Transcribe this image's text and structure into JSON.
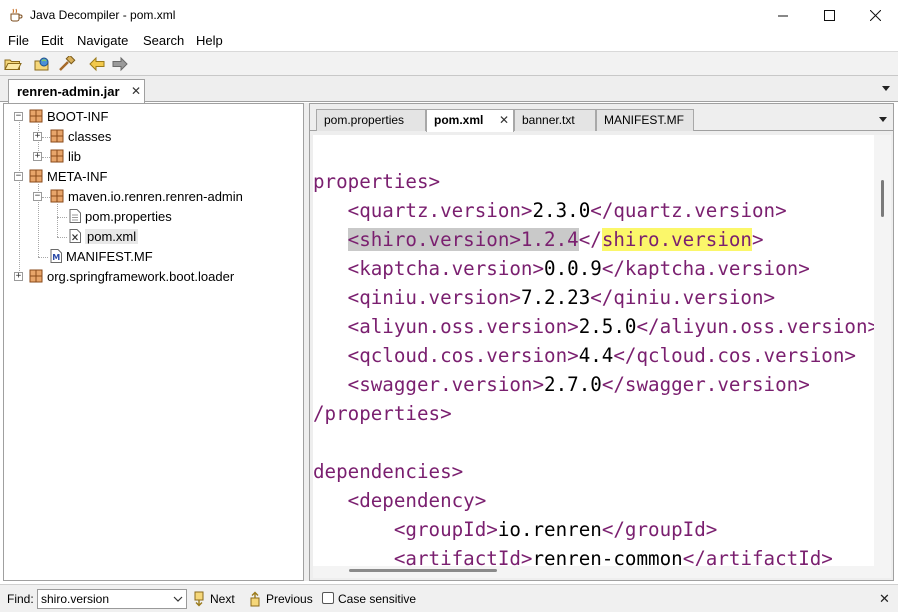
{
  "window": {
    "title": "Java Decompiler - pom.xml"
  },
  "menu": {
    "items": [
      "File",
      "Edit",
      "Navigate",
      "Search",
      "Help"
    ]
  },
  "toolbar": {
    "icons": [
      "open-folder-icon",
      "open-type-icon",
      "search-hammer-icon",
      "back-arrow-icon",
      "forward-arrow-icon"
    ]
  },
  "jar_tab": {
    "label": "renren-admin.jar",
    "close": "✕"
  },
  "tree": {
    "nodes": [
      {
        "label": "BOOT-INF",
        "type": "package",
        "expanded": true
      },
      {
        "label": "classes",
        "type": "package",
        "expanded": false
      },
      {
        "label": "lib",
        "type": "package",
        "expanded": false
      },
      {
        "label": "META-INF",
        "type": "package",
        "expanded": true
      },
      {
        "label": "maven.io.renren.renren-admin",
        "type": "package",
        "expanded": true
      },
      {
        "label": "pom.properties",
        "type": "file"
      },
      {
        "label": "pom.xml",
        "type": "xml-file",
        "selected": true
      },
      {
        "label": "MANIFEST.MF",
        "type": "manifest-file"
      },
      {
        "label": "org.springframework.boot.loader",
        "type": "package",
        "expanded": false
      }
    ]
  },
  "file_tabs": {
    "tabs": [
      "pom.properties",
      "pom.xml",
      "banner.txt",
      "MANIFEST.MF"
    ],
    "active": "pom.xml",
    "close": "✕"
  },
  "editor": {
    "lines": [
      {
        "t1": "properties>"
      },
      {
        "t1": "   <quartz.version>",
        "t2": "2.3.0",
        "t3": "</quartz.version>"
      },
      {
        "t1": "   ",
        "sel1": "<shiro.version>1.2.4",
        "t3": "</",
        "match": "shiro.version",
        "t4": ">"
      },
      {
        "t1": "   <kaptcha.version>",
        "t2": "0.0.9",
        "t3": "</kaptcha.version>"
      },
      {
        "t1": "   <qiniu.version>",
        "t2": "7.2.23",
        "t3": "</qiniu.version>"
      },
      {
        "t1": "   <aliyun.oss.version>",
        "t2": "2.5.0",
        "t3": "</aliyun.oss.version>"
      },
      {
        "t1": "   <qcloud.cos.version>",
        "t2": "4.4",
        "t3": "</qcloud.cos.version>"
      },
      {
        "t1": "   <swagger.version>",
        "t2": "2.7.0",
        "t3": "</swagger.version>"
      },
      {
        "t1": "/properties>"
      },
      {
        "t1": ""
      },
      {
        "t1": "dependencies>"
      },
      {
        "t1": "   <dependency>"
      },
      {
        "t1": "       <groupId>",
        "t2": "io.renren",
        "t3": "</groupId>"
      },
      {
        "t1": "       <artifactId>",
        "t2": "renren-common",
        "t3": "</artifactId>"
      }
    ]
  },
  "findbar": {
    "label": "Find:",
    "value": "shiro.version",
    "next_label": "Next",
    "previous_label": "Previous",
    "case_label": "Case sensitive",
    "case_checked": false,
    "close": "✕"
  },
  "colors": {
    "tag": "#7a1f6f",
    "selection": "#c9c9c9",
    "match": "#fbf76a",
    "package_icon": "#c8722a"
  }
}
